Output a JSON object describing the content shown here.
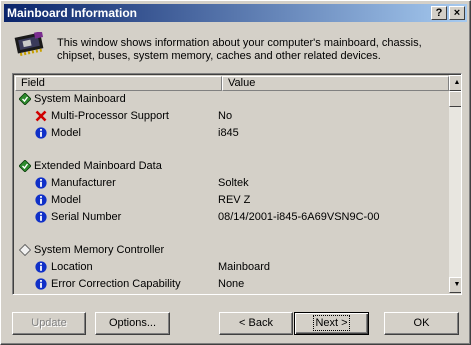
{
  "window": {
    "title": "Mainboard Information",
    "help_label": "?",
    "close_label": "×"
  },
  "description": "This window shows information about your computer's mainboard, chassis, chipset, buses, system memory, caches and other related devices.",
  "columns": {
    "field": "Field",
    "value": "Value"
  },
  "rows": [
    {
      "type": "group",
      "icon": "green-diamond-icon",
      "label": "System Mainboard",
      "value": ""
    },
    {
      "type": "item",
      "icon": "red-x-icon",
      "label": "Multi-Processor Support",
      "value": "No"
    },
    {
      "type": "item",
      "icon": "info-icon",
      "label": "Model",
      "value": "i845"
    },
    {
      "type": "blank",
      "label": "",
      "value": ""
    },
    {
      "type": "group",
      "icon": "green-diamond-icon",
      "label": "Extended Mainboard Data",
      "value": ""
    },
    {
      "type": "item",
      "icon": "info-icon",
      "label": "Manufacturer",
      "value": "Soltek"
    },
    {
      "type": "item",
      "icon": "info-icon",
      "label": "Model",
      "value": "REV Z"
    },
    {
      "type": "item",
      "icon": "info-icon",
      "label": "Serial Number",
      "value": "08/14/2001-i845-6A69VSN9C-00"
    },
    {
      "type": "blank",
      "label": "",
      "value": ""
    },
    {
      "type": "group",
      "icon": "gray-diamond-icon",
      "label": "System Memory Controller",
      "value": ""
    },
    {
      "type": "item",
      "icon": "info-icon",
      "label": "Location",
      "value": "Mainboard"
    },
    {
      "type": "item",
      "icon": "info-icon",
      "label": "Error Correction Capability",
      "value": "None"
    }
  ],
  "buttons": {
    "update": "Update",
    "options": "Options...",
    "back": "< Back",
    "next": "Next >",
    "ok": "OK"
  }
}
